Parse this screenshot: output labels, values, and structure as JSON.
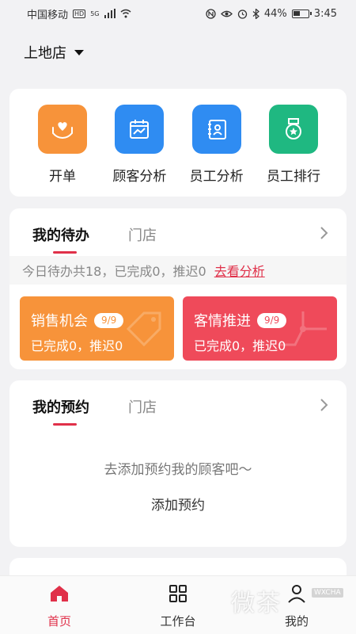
{
  "status_bar": {
    "carrier": "中国移动",
    "carrier_badge": "HD",
    "signal": "5G",
    "battery": "44%",
    "time": "3:45"
  },
  "store_selector": {
    "label": "上地店",
    "icon": "caret-down-icon"
  },
  "quick_actions": [
    {
      "label": "开单",
      "icon": "heart-hands-icon",
      "color": "#f7933a"
    },
    {
      "label": "顾客分析",
      "icon": "calendar-chart-icon",
      "color": "#2f8cf2"
    },
    {
      "label": "员工分析",
      "icon": "id-card-icon",
      "color": "#2f8cf2"
    },
    {
      "label": "员工排行",
      "icon": "medal-icon",
      "color": "#1fb881"
    }
  ],
  "todo": {
    "tab_active": "我的待办",
    "tab_other": "门店",
    "summary": "今日待办共18，已完成0，推迟0",
    "link": "去看分析",
    "tiles": [
      {
        "title": "销售机会",
        "badge": "9/9",
        "sub": "已完成0，推迟0",
        "color": "#f7933a"
      },
      {
        "title": "客情推进",
        "badge": "9/9",
        "sub": "已完成0，推迟0",
        "color": "#ef4a5a"
      }
    ]
  },
  "appointments": {
    "tab_active": "我的预约",
    "tab_other": "门店",
    "empty_text": "去添加预约我的顾客吧～",
    "add_label": "添加预约"
  },
  "bottom_nav": [
    {
      "label": "首页",
      "icon": "home-icon",
      "active": true
    },
    {
      "label": "工作台",
      "icon": "grid-icon",
      "active": false
    },
    {
      "label": "我的",
      "icon": "user-icon",
      "active": false
    }
  ],
  "watermark": {
    "text": "微茶",
    "tag": "WXCHA"
  },
  "accent_color": "#e03049"
}
